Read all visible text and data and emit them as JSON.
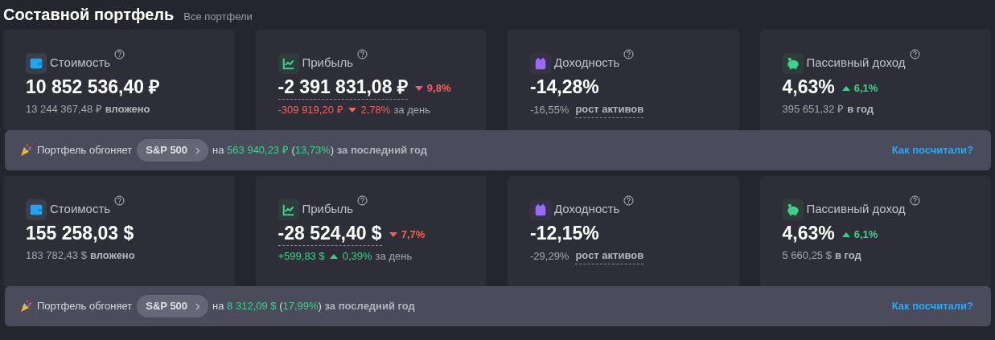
{
  "header": {
    "title": "Составной портфель",
    "link": "Все портфели"
  },
  "sections": [
    {
      "cards": [
        {
          "kind": "wallet",
          "title": "Стоимость",
          "value": "10 852 536,40 ₽",
          "value_underlined": false,
          "details": [
            {
              "kind": "muted",
              "text": "13 244 367,48 ₽"
            },
            {
              "kind": "bold",
              "text": "вложено"
            }
          ]
        },
        {
          "kind": "chart",
          "title": "Прибыль",
          "value": "-2 391 831,08 ₽",
          "value_underlined": true,
          "badge": {
            "text": "9,8%",
            "kind": "fall"
          },
          "details": [
            {
              "kind": "loss",
              "text": "-309 919,20 ₽"
            },
            {
              "kind": "fall"
            },
            {
              "kind": "loss",
              "text": "2,78%"
            },
            {
              "kind": "muted",
              "text": "за день"
            }
          ]
        },
        {
          "kind": "calendar",
          "title": "Доходность",
          "value": "-14,28%",
          "value_underlined": false,
          "details": [
            {
              "kind": "muted",
              "text": "-16,55%"
            },
            {
              "kind": "link",
              "text": "рост активов"
            }
          ]
        },
        {
          "kind": "piggy",
          "title": "Пассивный доход",
          "value": "4,63%",
          "value_underlined": false,
          "badge": {
            "text": "6,1%",
            "kind": "rise"
          },
          "details": [
            {
              "kind": "muted",
              "text": "395 651,32 ₽"
            },
            {
              "kind": "bold",
              "text": "в год"
            }
          ]
        }
      ],
      "banner": {
        "lead": "Портфель обгоняет",
        "chip": "S&P 500",
        "tail": [
          {
            "kind": "plain",
            "text": "на "
          },
          {
            "kind": "gain",
            "text": "563 940,23 ₽"
          },
          {
            "kind": "plain",
            "text": " ("
          },
          {
            "kind": "gain",
            "text": "13,73%"
          },
          {
            "kind": "plain",
            "text": ")"
          },
          {
            "kind": "bold",
            "text": " за последний год"
          }
        ],
        "link": "Как посчитали?"
      }
    },
    {
      "cards": [
        {
          "kind": "wallet",
          "title": "Стоимость",
          "value": "155 258,03 $",
          "value_underlined": false,
          "details": [
            {
              "kind": "muted",
              "text": "183 782,43 $"
            },
            {
              "kind": "bold",
              "text": "вложено"
            }
          ]
        },
        {
          "kind": "chart",
          "title": "Прибыль",
          "value": "-28 524,40 $",
          "value_underlined": true,
          "badge": {
            "text": "7,7%",
            "kind": "fall"
          },
          "details": [
            {
              "kind": "gain",
              "text": "+599,83 $"
            },
            {
              "kind": "rise"
            },
            {
              "kind": "gain",
              "text": "0,39%"
            },
            {
              "kind": "muted",
              "text": "за день"
            }
          ]
        },
        {
          "kind": "calendar",
          "title": "Доходность",
          "value": "-12,15%",
          "value_underlined": false,
          "details": [
            {
              "kind": "muted",
              "text": "-29,29%"
            },
            {
              "kind": "link",
              "text": "рост активов"
            }
          ]
        },
        {
          "kind": "piggy",
          "title": "Пассивный доход",
          "value": "4,63%",
          "value_underlined": false,
          "badge": {
            "text": "6,1%",
            "kind": "rise"
          },
          "details": [
            {
              "kind": "muted",
              "text": "5 660,25 $"
            },
            {
              "kind": "bold",
              "text": "в год"
            }
          ]
        }
      ],
      "banner": {
        "lead": "Портфель обгоняет",
        "chip": "S&P 500",
        "tail": [
          {
            "kind": "plain",
            "text": "на "
          },
          {
            "kind": "gain",
            "text": "8 312,09 $"
          },
          {
            "kind": "plain",
            "text": " ("
          },
          {
            "kind": "gain",
            "text": "17,99%"
          },
          {
            "kind": "plain",
            "text": ")"
          },
          {
            "kind": "bold",
            "text": " за последний год"
          }
        ],
        "link": "Как посчитали?"
      }
    }
  ]
}
